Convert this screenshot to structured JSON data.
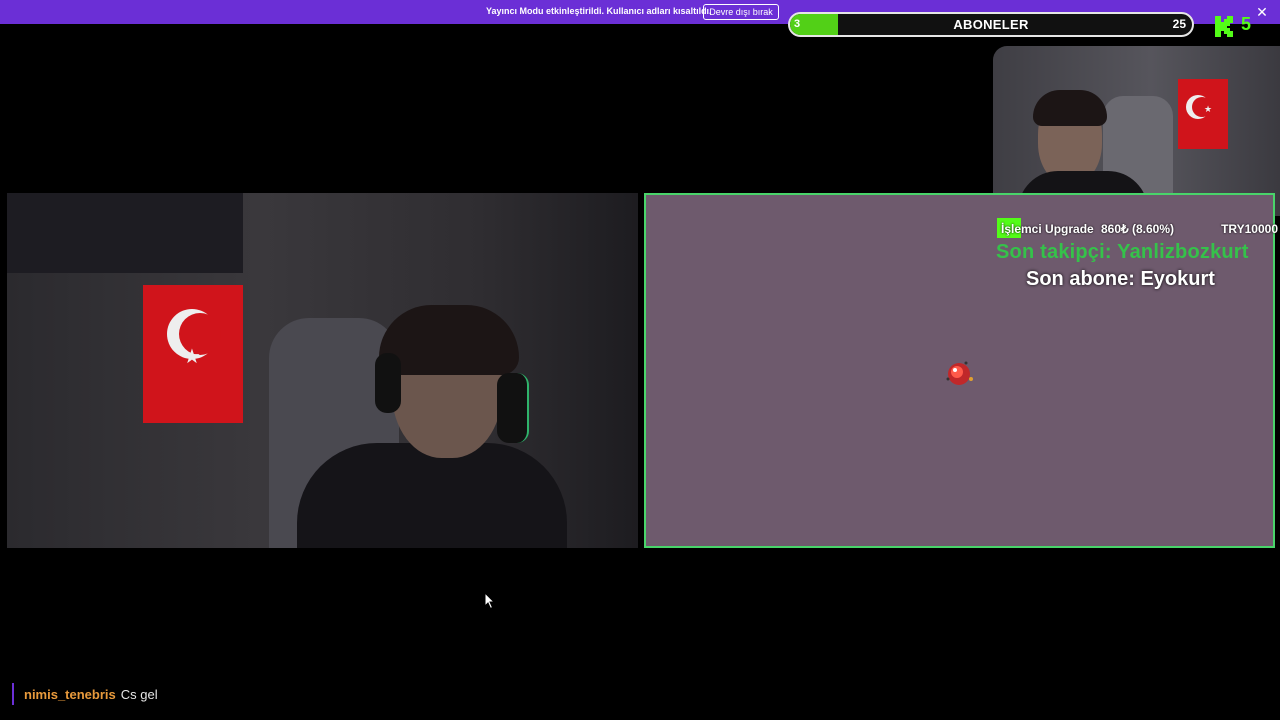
{
  "banner": {
    "message": "Yayıncı Modu etkinleştirildi. Kullanıcı adları kısaltıldı.",
    "button_label": "Devre dışı bırak",
    "close_glyph": "✕"
  },
  "sub_goal": {
    "current": "3",
    "title": "ABONELER",
    "target": "25",
    "progress_fraction": 0.12,
    "fill_color": "#52d017"
  },
  "kick_badge": {
    "logo_icon": "kick-logo-icon",
    "count": "5",
    "accent": "#53fc18"
  },
  "donation": {
    "label": "İşlemci Upgrade",
    "amount": "860₺ (8.60%)",
    "target": "TRY10000"
  },
  "overlays": {
    "last_follower": "Son takipçi: Yanlizbozkurt",
    "last_subscriber": "Son abone: Eyokurt"
  },
  "chat": {
    "messages": [
      {
        "user": "nimis_tenebris",
        "text": "Cs gel"
      }
    ]
  },
  "colors": {
    "brand_purple": "#6b2fd6",
    "kick_green": "#53fc18",
    "game_bg": "#6e5a6d",
    "game_border": "#49d46a"
  }
}
